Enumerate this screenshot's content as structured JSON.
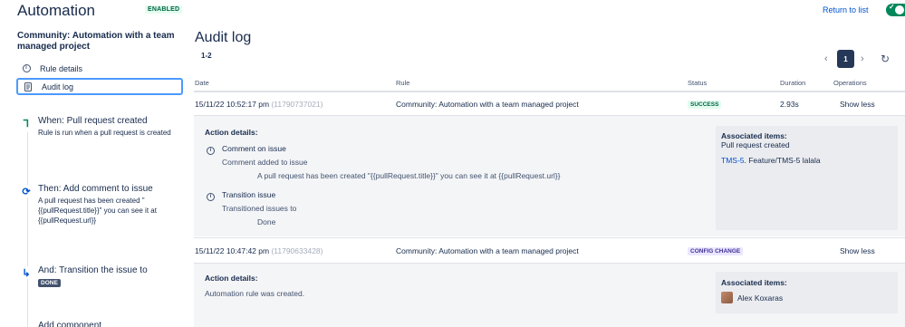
{
  "header": {
    "title": "Automation",
    "enabled_badge": "ENABLED",
    "return_link": "Return to list",
    "toggle_check": "✓"
  },
  "sidebar": {
    "rule_name": "Community: Automation with a team managed project",
    "nav": [
      {
        "label": "Rule details",
        "icon": "info-icon"
      },
      {
        "label": "Audit log",
        "icon": "document-icon"
      }
    ],
    "steps": [
      {
        "title": "When: Pull request created",
        "desc": "Rule is run when a pull request is created",
        "icon": "branch-icon"
      },
      {
        "title": "Then: Add comment to issue",
        "desc": "A pull request has been created \"{{pullRequest.title}}\" you can see it at {{pullRequest.url}}",
        "icon": "refresh-action-icon"
      },
      {
        "title": "And: Transition the issue to",
        "badge": "DONE",
        "icon": "transition-icon"
      },
      {
        "title": "Add component"
      }
    ]
  },
  "main": {
    "title": "Audit log",
    "count": "1-2",
    "pager": {
      "prev": "‹",
      "current": "1",
      "next": "›",
      "refresh": "↻"
    },
    "columns": [
      "Date",
      "Rule",
      "Status",
      "Duration",
      "Operations"
    ],
    "rows": [
      {
        "date": "15/11/22 10:52:17 pm",
        "id": "(11790737021)",
        "rule": "Community: Automation with a team managed project",
        "status": "SUCCESS",
        "duration": "2.93s",
        "operation": "Show less",
        "details": {
          "heading": "Action details:",
          "actions": [
            {
              "title": "Comment on issue",
              "sub": "Comment added to issue",
              "value": "A pull request has been created \"{{pullRequest.title}}\" you can see it at {{pullRequest.url}}"
            },
            {
              "title": "Transition issue",
              "sub": "Transitioned issues to",
              "value": "Done"
            }
          ],
          "assoc_heading": "Associated items:",
          "assoc_sub": "Pull request created",
          "assoc_link": "TMS-5",
          "assoc_text": ". Feature/TMS-5 lalala"
        }
      },
      {
        "date": "15/11/22 10:47:42 pm",
        "id": "(11790633428)",
        "rule": "Community: Automation with a team managed project",
        "status": "CONFIG CHANGE",
        "duration": "",
        "operation": "Show less",
        "details": {
          "heading": "Action details:",
          "text": "Automation rule was created.",
          "assoc_heading": "Associated items:",
          "assoc_user": "Alex Koxaras"
        }
      }
    ]
  },
  "colors": {
    "accent": "#0052cc",
    "success": "#006644",
    "config": "#403294",
    "toggle": "#00875a"
  }
}
